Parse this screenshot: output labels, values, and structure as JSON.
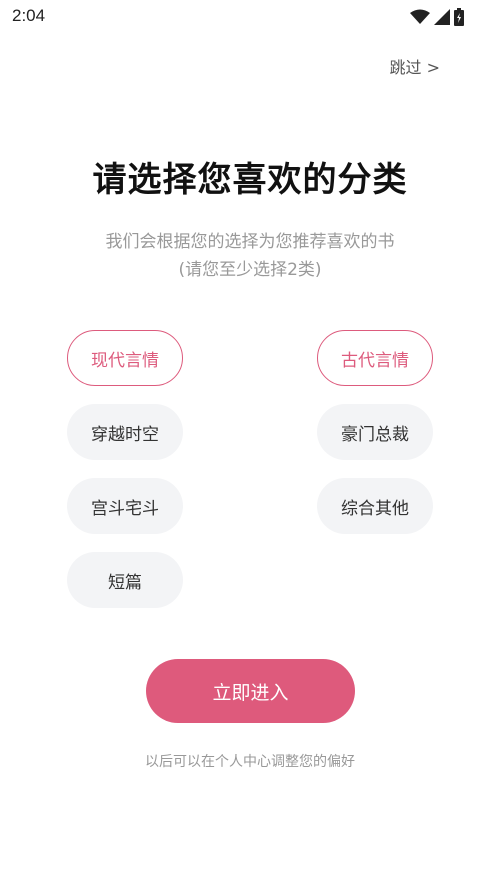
{
  "status_bar": {
    "time": "2:04",
    "icons": [
      "wifi-icon",
      "signal-icon",
      "battery-icon"
    ]
  },
  "header": {
    "skip_label": "跳过 >"
  },
  "main": {
    "title": "请选择您喜欢的分类",
    "subtitle_line1": "我们会根据您的选择为您推荐喜欢的书",
    "subtitle_line2": "(请您至少选择2类)"
  },
  "categories": [
    {
      "label": "现代言情",
      "selected": true
    },
    {
      "label": "古代言情",
      "selected": true
    },
    {
      "label": "穿越时空",
      "selected": false
    },
    {
      "label": "豪门总裁",
      "selected": false
    },
    {
      "label": "宫斗宅斗",
      "selected": false
    },
    {
      "label": "综合其他",
      "selected": false
    },
    {
      "label": "短篇",
      "selected": false
    }
  ],
  "actions": {
    "enter_label": "立即进入"
  },
  "footer": {
    "hint": "以后可以在个人中心调整您的偏好"
  },
  "colors": {
    "accent": "#de5a7c",
    "chip_bg": "#f3f4f6",
    "hint_text": "#999999"
  }
}
